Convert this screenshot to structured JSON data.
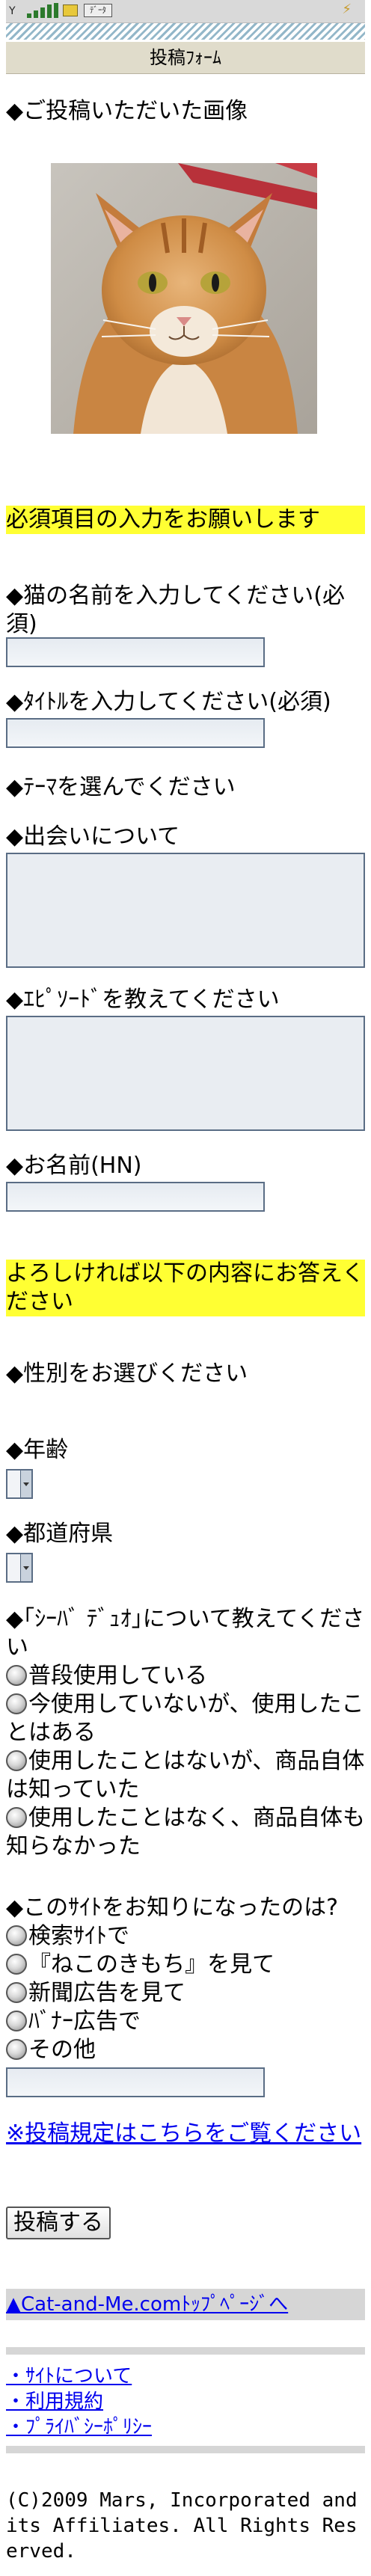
{
  "status_bar": {
    "mail_label": "ﾃﾞｰﾀ"
  },
  "header": {
    "title": "投稿ﾌｫｰﾑ"
  },
  "image_section": {
    "heading": "◆ご投稿いただいた画像"
  },
  "required_notice": "必須項目の入力をお願いします",
  "cat_name": {
    "label": "◆猫の名前を入力してください(必須)"
  },
  "post_title": {
    "label": "◆ﾀｲﾄﾙを入力してください(必須)"
  },
  "theme": {
    "label": "◆ﾃｰﾏを選んでください"
  },
  "meeting": {
    "label": "◆出会いについて"
  },
  "episode": {
    "label": "◆ｴﾋﾟｿｰﾄﾞを教えてください"
  },
  "nickname": {
    "label": "◆お名前(HN)"
  },
  "optional_notice": "よろしければ以下の内容にお答えください",
  "gender": {
    "label": "◆性別をお選びください"
  },
  "age": {
    "label": "◆年齢"
  },
  "prefecture": {
    "label": "◆都道府県"
  },
  "sheba_duo": {
    "label": "◆｢ｼｰﾊﾞ ﾃﾞｭｵ｣について教えてください",
    "options": [
      "普段使用している",
      "今使用していないが、使用したことはある",
      "使用したことはないが、商品自体は知っていた",
      "使用したことはなく、商品自体も知らなかった"
    ]
  },
  "referral": {
    "label": "◆このｻｲﾄをお知りになったのは?",
    "options": [
      "検索ｻｲﾄで",
      "『ねこのきもち』を見て",
      "新聞広告を見て",
      "ﾊﾞﾅｰ広告で",
      "その他"
    ]
  },
  "rules_link": "※投稿規定はこちらをご覧ください",
  "submit_button": "投稿する",
  "top_link": "▲Cat-and-Me.comﾄｯﾌﾟﾍﾟｰｼﾞへ",
  "footer_links": [
    "・ｻｲﾄについて",
    "・利用規約",
    "・ﾌﾟﾗｲﾊﾞｼｰﾎﾟﾘｼｰ"
  ],
  "copyright": "(C)2009 Mars, Incorporated and its Affiliates. All Rights Reserved.",
  "colors": {
    "highlight": "#ffff33",
    "link": "#0000ee",
    "title_bar": "#e0dccb",
    "field_border": "#5a6d85"
  }
}
